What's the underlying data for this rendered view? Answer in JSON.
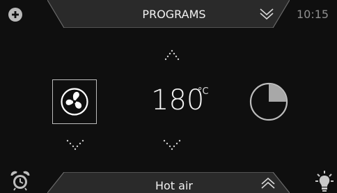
{
  "header": {
    "title": "PROGRAMS",
    "time": "10:15"
  },
  "main": {
    "temperature": {
      "value": "180",
      "unit": "°C"
    },
    "mode": {
      "icon": "fan-icon"
    },
    "timer": {
      "icon": "timer-pie-icon",
      "elapsed_fraction": 0.25
    }
  },
  "footer": {
    "mode_label": "Hot air"
  },
  "colors": {
    "background": "#0f0f0f",
    "text": "#e9e9e9",
    "muted": "#8f8f8f",
    "accent": "#bdbdbd"
  }
}
